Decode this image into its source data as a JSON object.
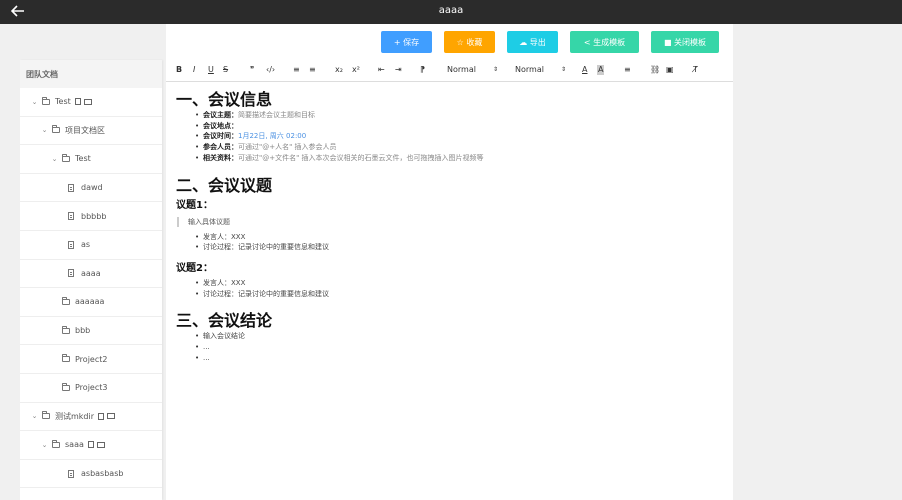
{
  "window": {
    "title": "aaaa"
  },
  "colors": {
    "save": "#409eff",
    "collect": "#ffa500",
    "export": "#1ecde5",
    "generate": "#36d6a8",
    "close": "#36d6a8",
    "topbar": "#2b2b2b"
  },
  "buttons": {
    "save": "+ 保存",
    "collect": "☆ 收藏",
    "export": "☁ 导出",
    "generate": "< 生成模板",
    "close": "■ 关闭模板"
  },
  "toolbar": {
    "bold": "B",
    "italic": "I",
    "underline": "U",
    "strike": "S",
    "quote": "❞",
    "code": "‹/›",
    "ol": "≡",
    "ul": "≡",
    "sub": "x₂",
    "sup": "x²",
    "outdent": "⇤",
    "indent": "⇥",
    "rtl": "⁋",
    "size_select": "Normal",
    "header_select": "Normal",
    "font_color": "A",
    "bg_color": "A",
    "align": "≡",
    "link": "⛓",
    "image": "▣",
    "clean": "T̸"
  },
  "sidebar": {
    "header": "团队文档",
    "items": [
      {
        "label": "Test",
        "type": "folder",
        "expanded": true,
        "depth": 0,
        "actions": true
      },
      {
        "label": "项目文档区",
        "type": "folder",
        "expanded": true,
        "depth": 1
      },
      {
        "label": "Test",
        "type": "folder",
        "expanded": true,
        "depth": 2
      },
      {
        "label": "dawd",
        "type": "file",
        "depth": 3
      },
      {
        "label": "bbbbb",
        "type": "file",
        "depth": 3
      },
      {
        "label": "as",
        "type": "file",
        "depth": 3
      },
      {
        "label": "aaaa",
        "type": "file",
        "depth": 3
      },
      {
        "label": "aaaaaa",
        "type": "folder",
        "depth": 2
      },
      {
        "label": "bbb",
        "type": "folder",
        "depth": 2
      },
      {
        "label": "Project2",
        "type": "folder",
        "depth": 2
      },
      {
        "label": "Project3",
        "type": "folder",
        "depth": 2
      },
      {
        "label": "测试mkdir",
        "type": "folder",
        "expanded": true,
        "depth": 0,
        "actions": true
      },
      {
        "label": "saaa",
        "type": "folder",
        "expanded": true,
        "depth": 1,
        "actions": true
      },
      {
        "label": "asbasbasb",
        "type": "file",
        "depth": 3
      }
    ]
  },
  "doc": {
    "h1_info": "一、会议信息",
    "info": [
      {
        "label": "会议主题：",
        "value": "简要描述会议主题和目标"
      },
      {
        "label": "会议地点：",
        "value": ""
      },
      {
        "label": "会议时间：",
        "value": "1月22日, 周六 02:00"
      },
      {
        "label": "参会人员：",
        "value": "可通过\"@+人名\" 插入参会人员"
      },
      {
        "label": "相关资料：",
        "value": "可通过\"@+文件名\" 插入本次会议相关的石墨云文件，也可拖拽插入图片视频等"
      }
    ],
    "h1_topics": "二、会议议题",
    "topic1": "议题1：",
    "topic1_quote": "输入具体议题",
    "topic1_items": [
      "发言人：XXX",
      "讨论过程：记录讨论中的重要信息和建议"
    ],
    "topic2": "议题2：",
    "topic2_items": [
      "发言人：XXX",
      "讨论过程：记录讨论中的重要信息和建议"
    ],
    "h1_conclusion": "三、会议结论",
    "conclusion_items": [
      "输入会议结论",
      "...",
      "..."
    ]
  }
}
